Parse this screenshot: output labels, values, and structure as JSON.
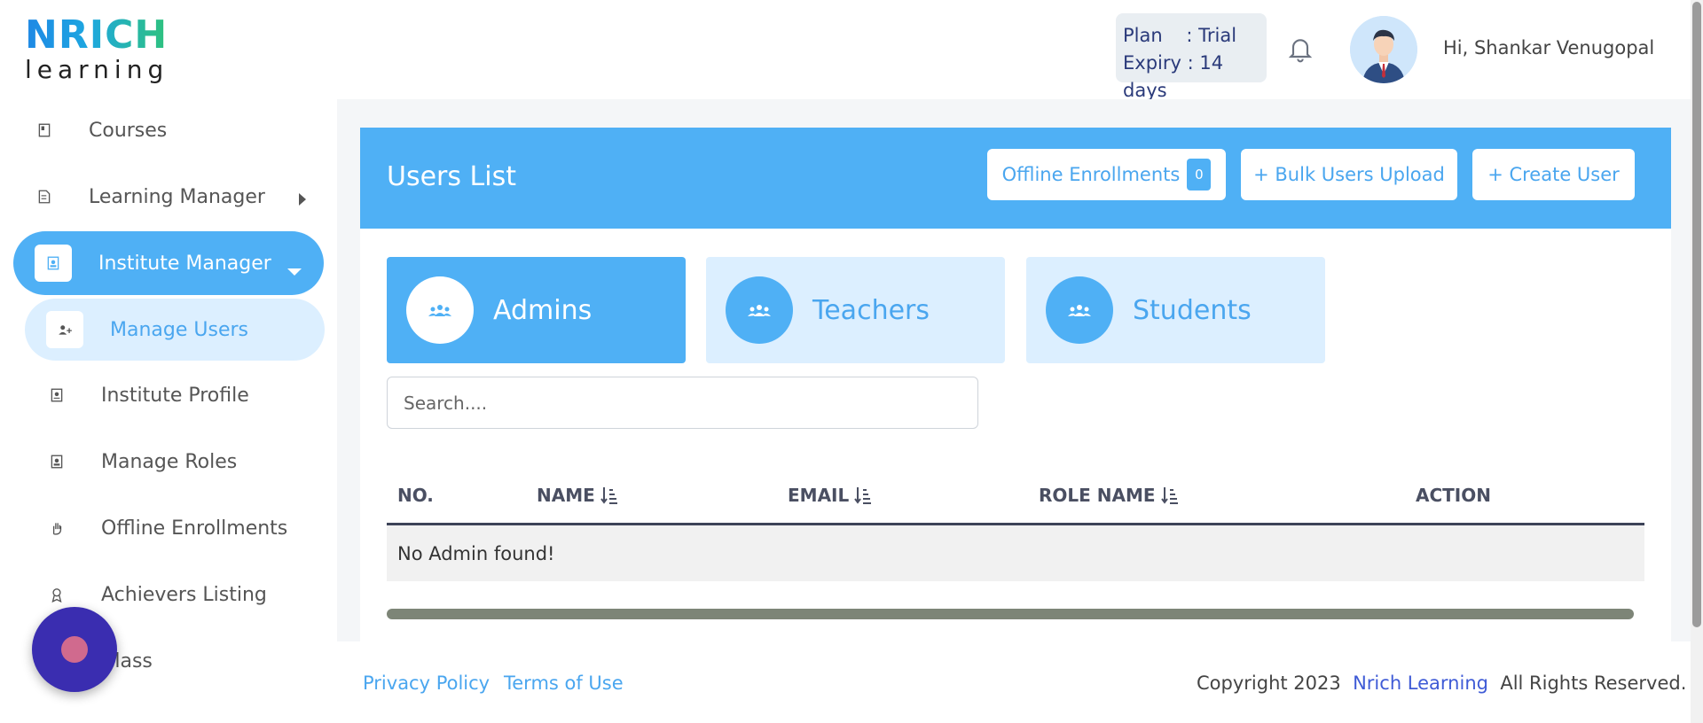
{
  "brand": {
    "logo_top": "NRICH",
    "logo_bottom": "learning"
  },
  "header": {
    "plan_label": "Plan    : Trial",
    "expiry_label": "Expiry : 14 days",
    "greeting": "Hi, Shankar Venugopal"
  },
  "sidebar": {
    "items": [
      {
        "label": "Courses",
        "icon": "book-icon"
      },
      {
        "label": "Learning Manager",
        "icon": "document-icon"
      },
      {
        "label": "Institute Manager",
        "icon": "institute-icon"
      },
      {
        "label": "Manage Users",
        "icon": "users-icon"
      },
      {
        "label": "Institute Profile",
        "icon": "profile-icon"
      },
      {
        "label": "Manage Roles",
        "icon": "roles-icon"
      },
      {
        "label": "Offline Enrollments",
        "icon": "hand-icon"
      },
      {
        "label": "Achievers Listing",
        "icon": "award-icon"
      },
      {
        "label": "Class",
        "icon": "class-icon"
      }
    ]
  },
  "main": {
    "title": "Users List",
    "buttons": {
      "offline_enrollments": "Offline Enrollments",
      "offline_count": "0",
      "bulk_upload": "+ Bulk Users Upload",
      "create_user": "+ Create User"
    },
    "tabs": [
      {
        "label": "Admins",
        "active": true
      },
      {
        "label": "Teachers",
        "active": false
      },
      {
        "label": "Students",
        "active": false
      }
    ],
    "search": {
      "placeholder": "Search...."
    },
    "table": {
      "columns": [
        "NO.",
        "NAME",
        "EMAIL",
        "ROLE NAME",
        "ACTION"
      ],
      "empty_message": "No Admin found!"
    }
  },
  "footer": {
    "privacy": "Privacy Policy",
    "terms": "Terms of Use",
    "copyright_prefix": "Copyright 2023",
    "brand": "Nrich Learning",
    "copyright_suffix": "All Rights Reserved."
  },
  "colors": {
    "accent": "#4fb0f5",
    "accent_light": "#dcefff",
    "fab": "#3a2db0"
  }
}
